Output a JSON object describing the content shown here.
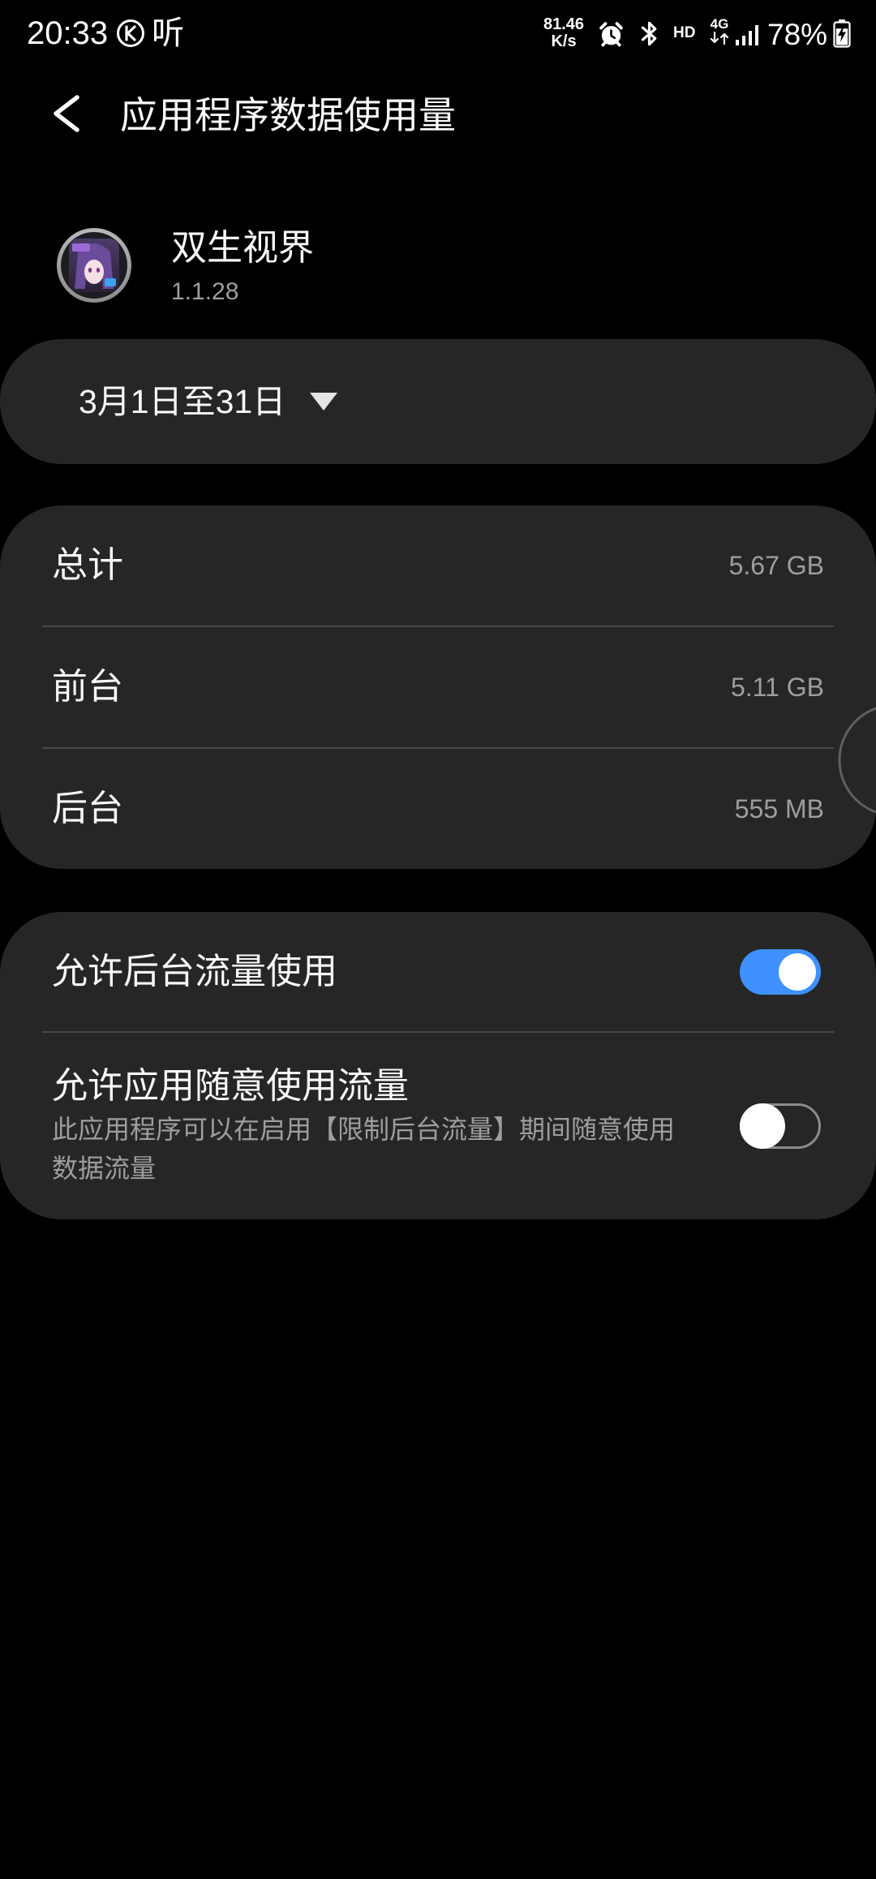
{
  "status_bar": {
    "time": "20:33",
    "notification_glyph": "听",
    "net_speed_value": "81.46",
    "net_speed_unit": "K/s",
    "hd_label": "HD",
    "network_type": "4G",
    "battery_percent": "78%",
    "icons": [
      "k-circle-icon",
      "alarm-icon",
      "bluetooth-icon",
      "network-arrows-icon",
      "signal-icon",
      "battery-charging-icon"
    ]
  },
  "header": {
    "title": "应用程序数据使用量",
    "back_icon": "back-arrow-icon"
  },
  "app": {
    "name": "双生视界",
    "version": "1.1.28",
    "icon": "app-icon"
  },
  "date_range": {
    "label": "3月1日至31日",
    "icon": "dropdown-triangle-icon"
  },
  "usage": {
    "rows": [
      {
        "label": "总计",
        "value": "5.67 GB"
      },
      {
        "label": "前台",
        "value": "5.11 GB"
      },
      {
        "label": "后台",
        "value": "555 MB"
      }
    ]
  },
  "settings": {
    "background_data": {
      "label": "允许后台流量使用",
      "enabled": true
    },
    "unrestricted_data": {
      "label": "允许应用随意使用流量",
      "description": "此应用程序可以在启用【限制后台流量】期间随意使用数据流量",
      "enabled": false
    }
  },
  "colors": {
    "background": "#000000",
    "card": "#262626",
    "accent": "#3e91ff",
    "text_primary": "#fafafa",
    "text_secondary": "#9e9e9e",
    "divider": "#474747",
    "toggle_off": "#8c8c8c"
  }
}
